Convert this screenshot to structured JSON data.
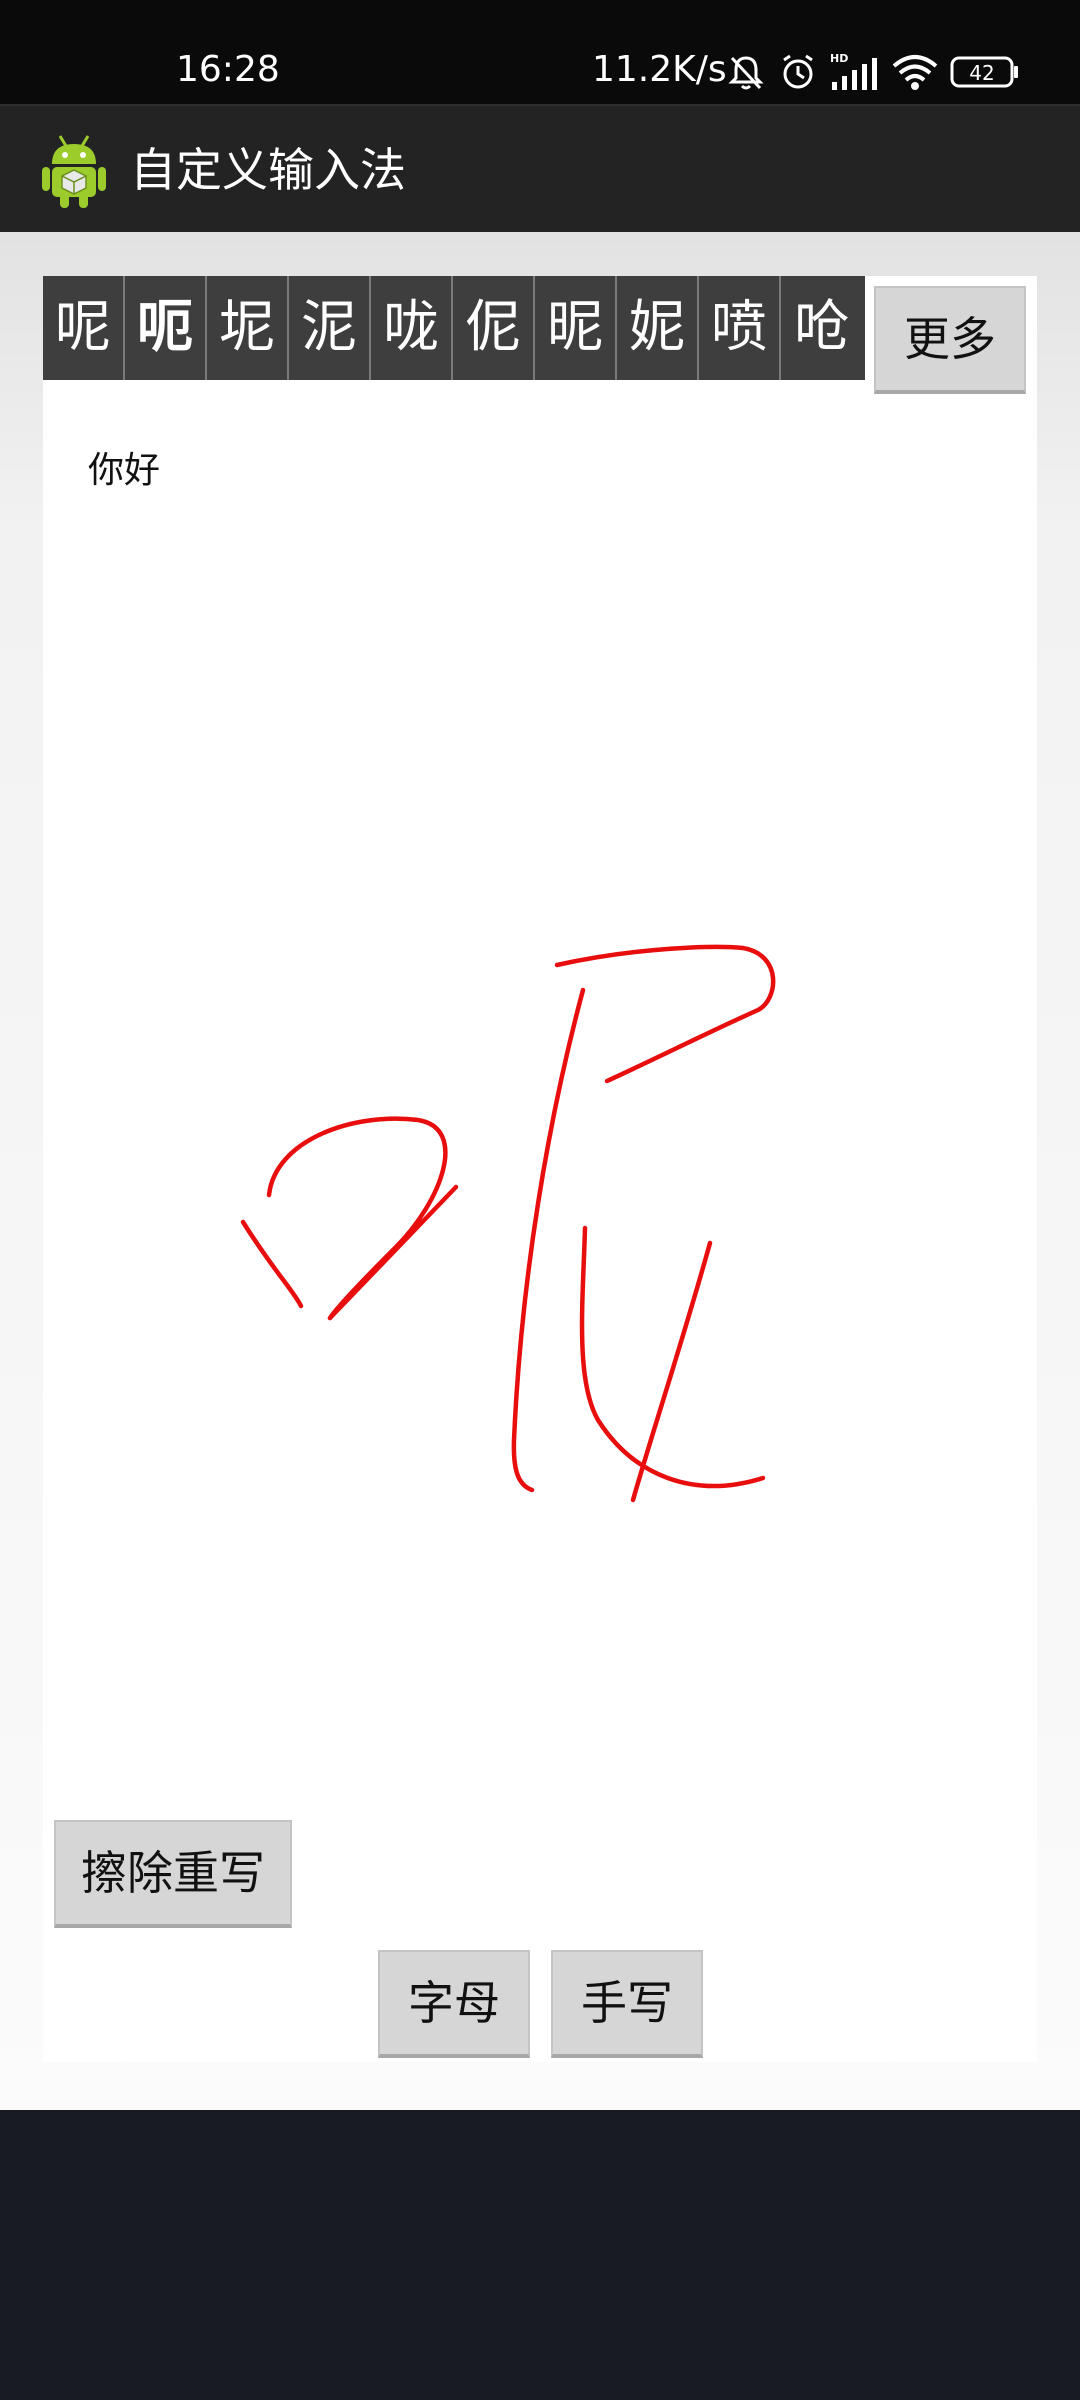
{
  "status_bar": {
    "time": "16:28",
    "network_speed": "11.2K/s",
    "battery_level": "42",
    "icons": [
      "mute-icon",
      "alarm-icon",
      "hd-icon",
      "signal-icon",
      "wifi-icon",
      "battery-icon"
    ]
  },
  "app_bar": {
    "title": "自定义输入法",
    "icon": "android-icon"
  },
  "candidates": [
    "呢",
    "呃",
    "坭",
    "泥",
    "咙",
    "伲",
    "昵",
    "妮",
    "喷",
    "呛"
  ],
  "buttons": {
    "more": "更多",
    "clear_rewrite": "擦除重写",
    "letters": "字母",
    "handwriting": "手写"
  },
  "input_text": "你好",
  "colors": {
    "ink": "#e80e0e",
    "candidate_bg": "#3e3e3e",
    "app_bar": "#232323",
    "status_bar": "#0a0a0a",
    "button_bg": "#d6d6d6"
  }
}
